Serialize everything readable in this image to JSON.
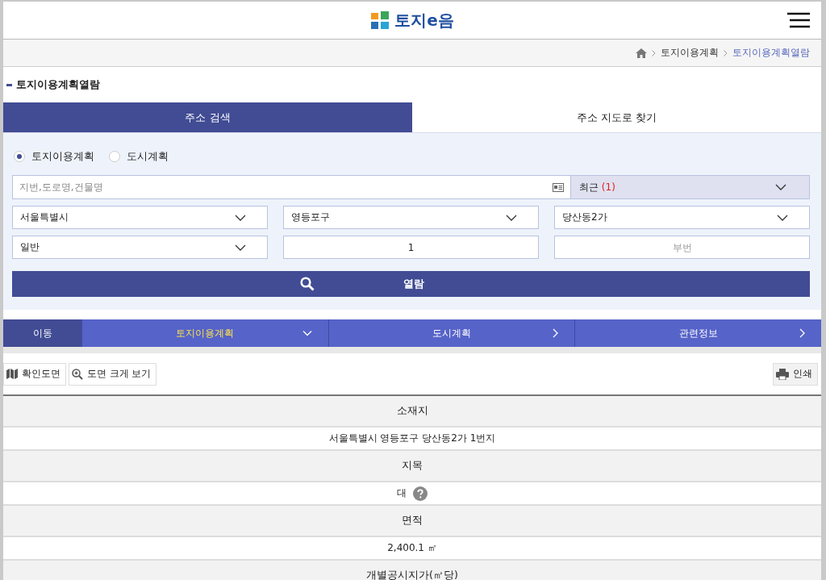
{
  "header": {
    "logo": "토지e음"
  },
  "breadcrumb": [
    "토지이용계획",
    "토지이용계획열람"
  ],
  "page_title": "토지이용계획열람",
  "tabs": [
    {
      "label": "주소 검색",
      "selected": true
    },
    {
      "label": "주소 지도로 찾기",
      "selected": false
    }
  ],
  "radios": [
    {
      "label": "토지이용계획",
      "selected": true
    },
    {
      "label": "도시계획",
      "selected": false
    }
  ],
  "search": {
    "placeholder": "지번,도로명,건물명"
  },
  "recent": {
    "label": "최근",
    "count": "(1)"
  },
  "fields": [
    {
      "kind": "select",
      "value": "서울특별시"
    },
    {
      "kind": "select",
      "value": "영등포구"
    },
    {
      "kind": "select",
      "value": "당산동2가"
    },
    {
      "kind": "select",
      "value": "일반"
    },
    {
      "kind": "input",
      "value": "1"
    },
    {
      "kind": "input",
      "placeholder": "부번"
    }
  ],
  "submit": "열람",
  "nav": [
    {
      "label": "이동",
      "kind": "plain",
      "selected": false
    },
    {
      "label": "토지이용계획",
      "kind": "down",
      "selected": true
    },
    {
      "label": "도시계획",
      "kind": "right",
      "selected": false
    },
    {
      "label": "관련정보",
      "kind": "right",
      "selected": false
    }
  ],
  "tools": [
    {
      "label": "확인도면",
      "kind": "map"
    },
    {
      "label": "도면 크게 보기",
      "kind": "zoom"
    }
  ],
  "print": "인쇄",
  "rows": [
    {
      "kind": "head",
      "text": "소재지"
    },
    {
      "kind": "value",
      "text": "서울특별시 영등포구 당산동2가 1번지",
      "help": false
    },
    {
      "kind": "head",
      "text": "지목"
    },
    {
      "kind": "value",
      "text": "대",
      "help": true
    },
    {
      "kind": "head",
      "text": "면적"
    },
    {
      "kind": "value",
      "text": "2,400.1 ㎡",
      "help": false
    },
    {
      "kind": "head",
      "text": "개별공시지가(㎡당)"
    }
  ]
}
